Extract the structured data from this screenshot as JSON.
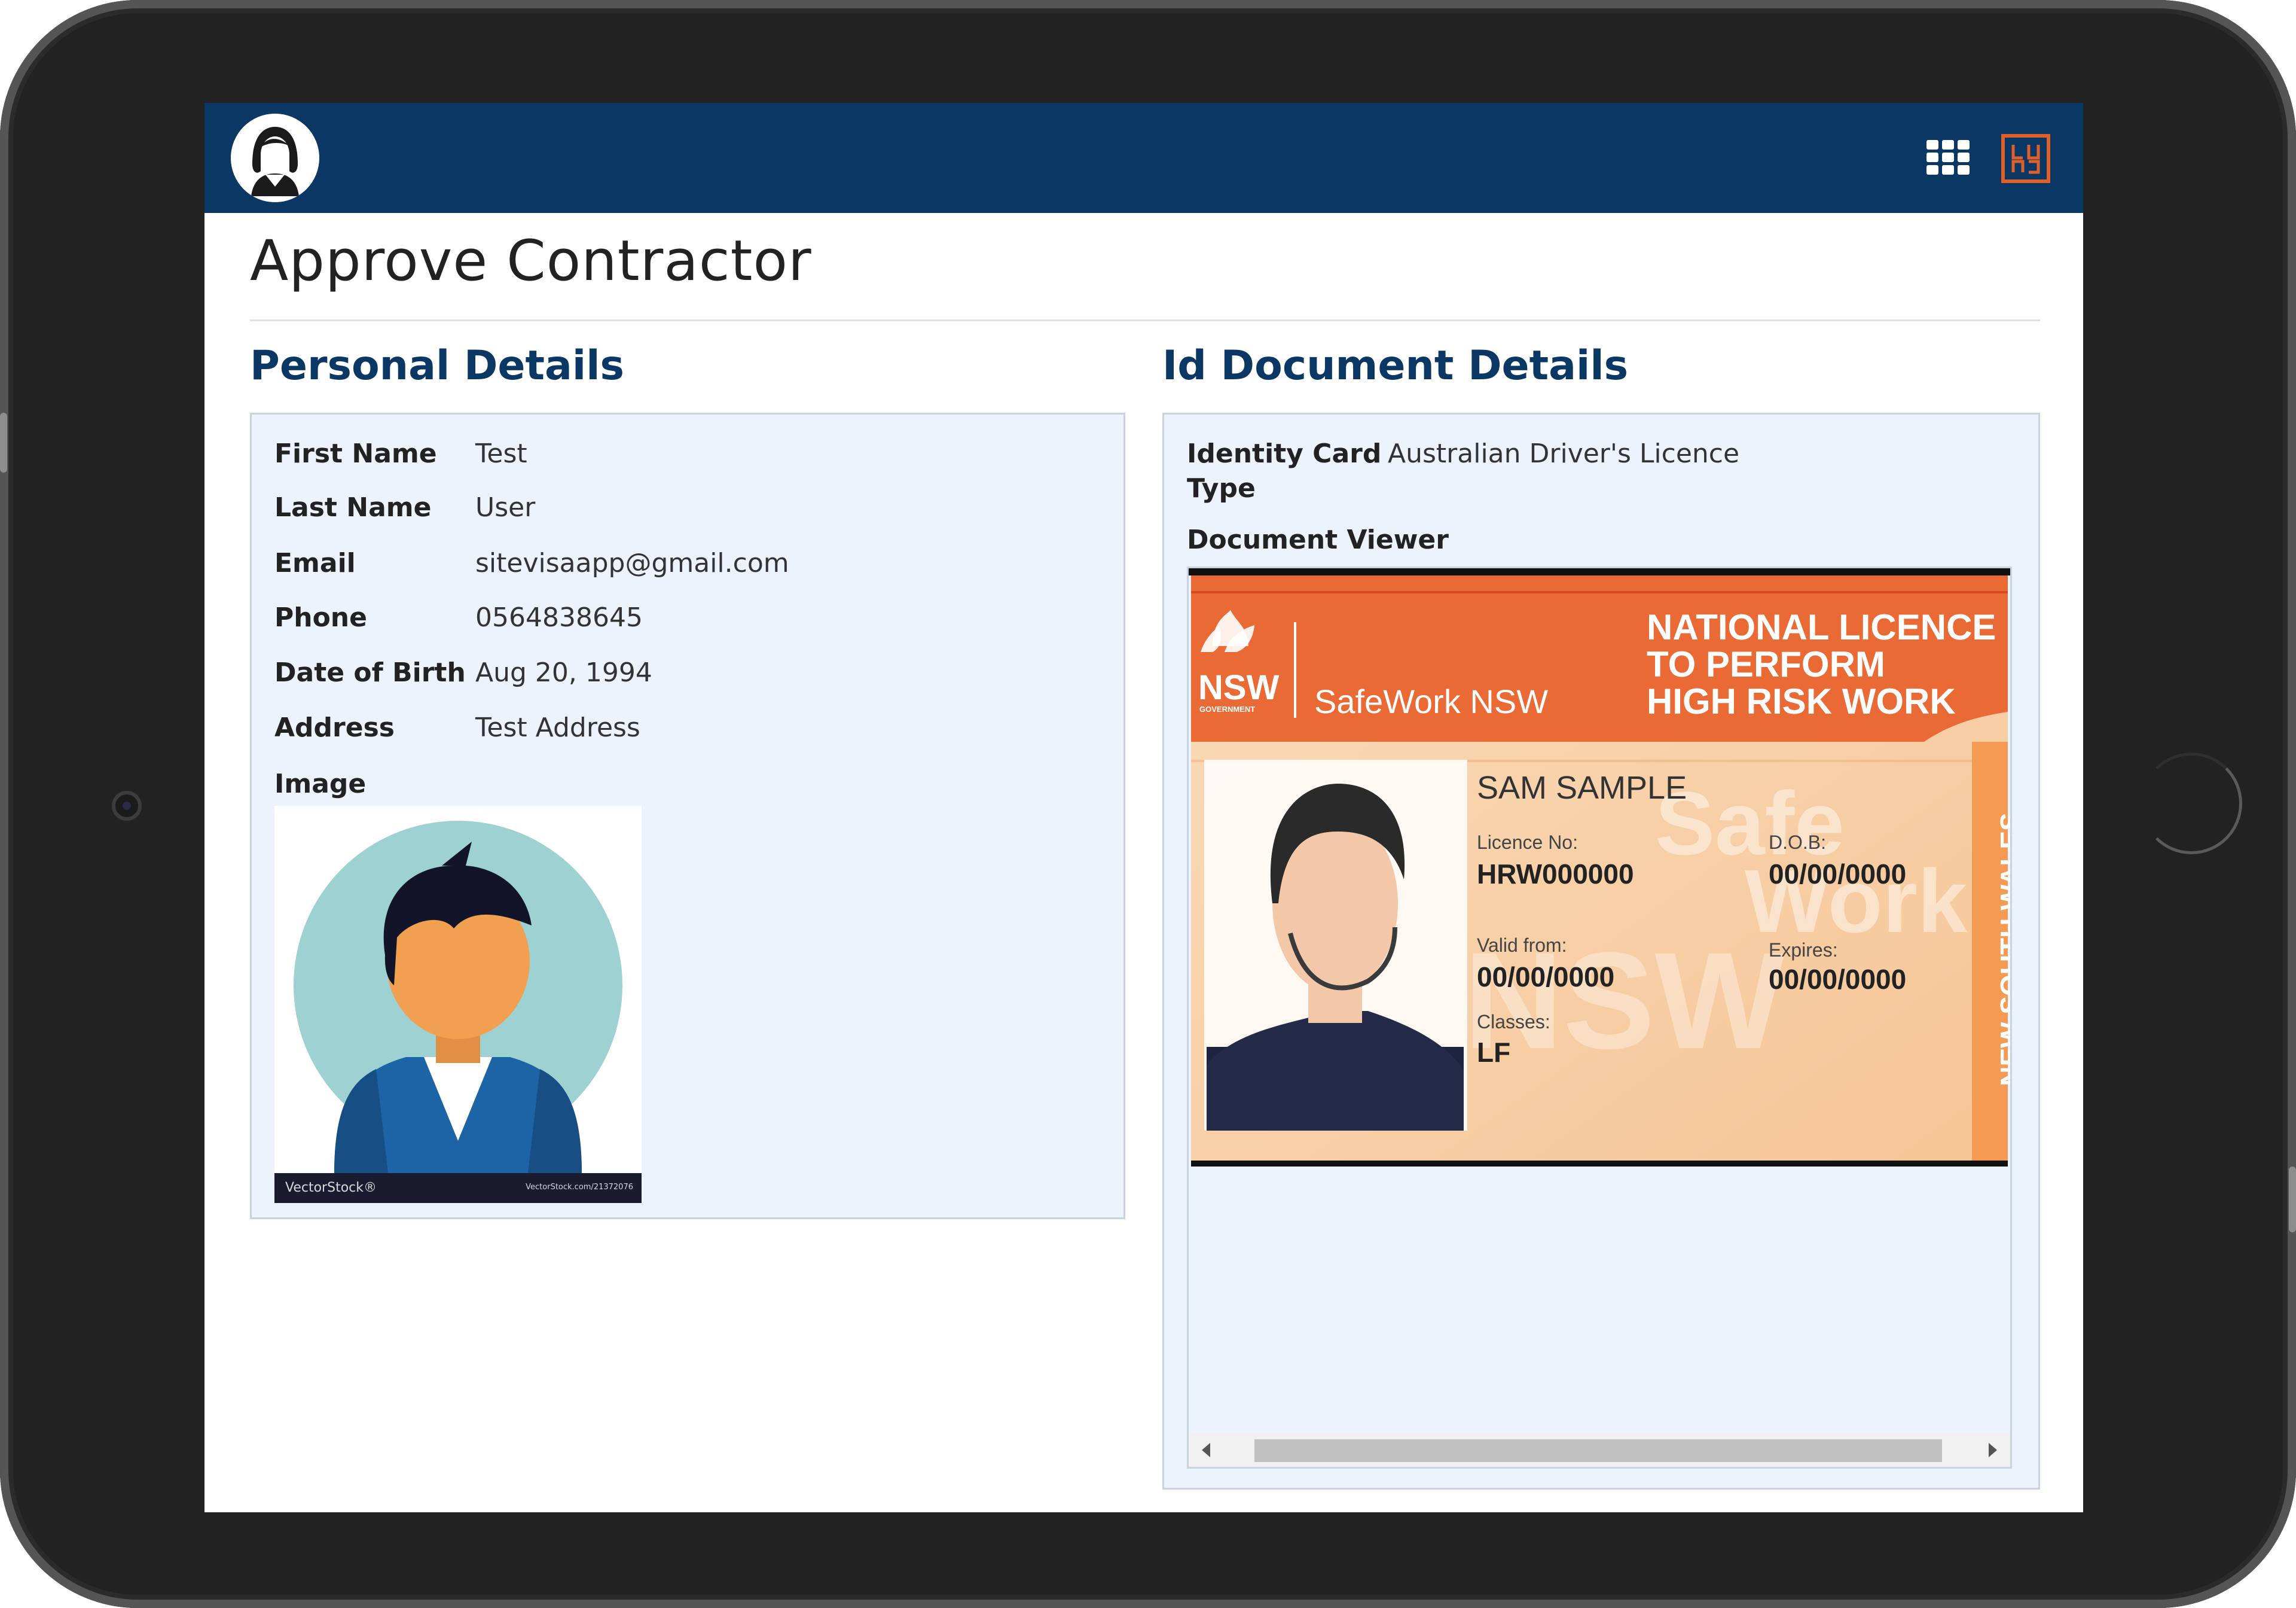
{
  "header": {
    "avatar_icon": "user-avatar-icon",
    "apps_icon": "grid-apps-icon",
    "logo_icon": "sitevisa-logo-icon",
    "background_color": "#0a3763",
    "accent_color": "#e0602a"
  },
  "page": {
    "title": "Approve Contractor"
  },
  "personal": {
    "title": "Personal Details",
    "fields": [
      {
        "label": "First Name",
        "value": "Test"
      },
      {
        "label": "Last Name",
        "value": "User"
      },
      {
        "label": "Email",
        "value": "sitevisaapp@gmail.com"
      },
      {
        "label": "Phone",
        "value": "0564838645"
      },
      {
        "label": "Date of Birth",
        "value": "Aug 20, 1994"
      },
      {
        "label": "Address",
        "value": "Test Address"
      }
    ],
    "image_label": "Image",
    "image_footer_brand": "VectorStock®",
    "image_footer_url": "VectorStock.com/21372076"
  },
  "id_document": {
    "title": "Id Document Details",
    "card_type_label_line1": "Identity Card",
    "card_type_label_line2": "Type",
    "card_type_value": "Australian Driver's Licence",
    "viewer_label": "Document Viewer",
    "card": {
      "gov_logo": "NSW",
      "gov_sub": "GOVERNMENT",
      "agency": "SafeWork NSW",
      "heading_line1": "NATIONAL LICENCE",
      "heading_line2": "TO PERFORM",
      "heading_line3": "HIGH RISK WORK",
      "name": "SAM SAMPLE",
      "licence_label": "Licence No:",
      "licence_value": "HRW000000",
      "dob_label": "D.O.B:",
      "dob_value": "00/00/0000",
      "valid_label": "Valid from:",
      "valid_value": "00/00/0000",
      "expires_label": "Expires:",
      "expires_value": "00/00/0000",
      "classes_label": "Classes:",
      "classes_value": "LF",
      "side_text": "NEW SOUTH WALES",
      "watermark_1": "Safe",
      "watermark_2": "Work",
      "watermark_3": "NSW"
    }
  }
}
